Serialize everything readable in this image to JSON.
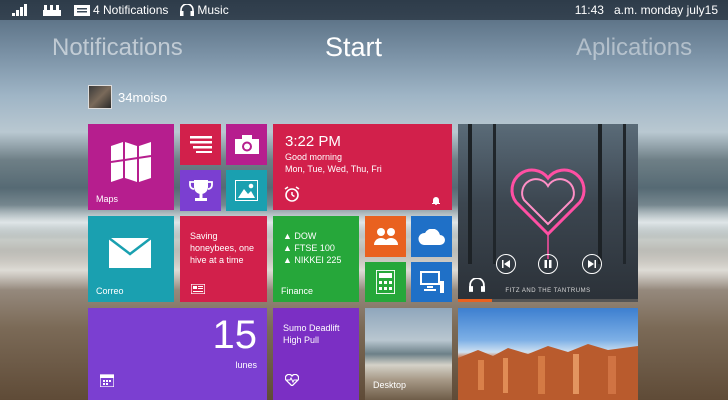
{
  "status": {
    "notifications": "4 Notifications",
    "music": "Music",
    "time": "11:43",
    "date": "a.m. monday july15"
  },
  "pivot": {
    "left": "Notifications",
    "center": "Start",
    "right": "Aplications"
  },
  "user": {
    "name": "34moiso"
  },
  "tiles": {
    "maps": {
      "label": "Maps"
    },
    "clock": {
      "time": "3:22 PM",
      "greeting": "Good morning",
      "days": "Mon, Tue, Wed, Thu, Fri"
    },
    "correo": {
      "label": "Correo"
    },
    "news": {
      "headline": "Saving honeybees, one hive at a time"
    },
    "finance": {
      "label": "Finance",
      "items": [
        "▲ DOW",
        "▲ FTSE 100",
        "▲ NIKKEI 225"
      ]
    },
    "music": {
      "artist": "FITZ AND THE TANTRUMS"
    },
    "calendar": {
      "day": "15",
      "weekday": "lunes"
    },
    "health": {
      "text": "Sumo Deadlift High Pull"
    },
    "desktop": {
      "label": "Desktop"
    }
  },
  "colors": {
    "maps": "#b61e8e",
    "calendar": "#7b3fd1",
    "health": "#7b2fc4",
    "clock": "#d2204b",
    "teal": "#1aa0b0",
    "finance": "#26a73a",
    "orange": "#e9611f",
    "blue": "#1f70c7"
  }
}
